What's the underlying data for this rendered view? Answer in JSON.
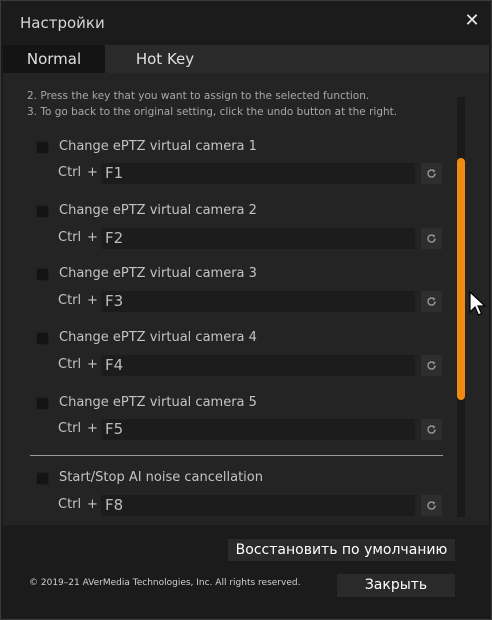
{
  "window": {
    "title": "Настройки",
    "close_glyph": "✕"
  },
  "tabs": [
    {
      "label": "Normal",
      "active": true
    },
    {
      "label": "Hot Key",
      "active": false
    }
  ],
  "instructions": [
    "2. Press the key that you want to assign to the selected function.",
    "3. To go back to the original setting, click the undo button at the right."
  ],
  "hotkeys": [
    {
      "label": "Change ePTZ virtual camera 1",
      "modifier": "Ctrl",
      "plus": "+",
      "key": "F1",
      "checked": false
    },
    {
      "label": "Change ePTZ virtual camera 2",
      "modifier": "Ctrl",
      "plus": "+",
      "key": "F2",
      "checked": false
    },
    {
      "label": "Change ePTZ virtual camera 3",
      "modifier": "Ctrl",
      "plus": "+",
      "key": "F3",
      "checked": false
    },
    {
      "label": "Change ePTZ virtual camera 4",
      "modifier": "Ctrl",
      "plus": "+",
      "key": "F4",
      "checked": false
    },
    {
      "label": "Change ePTZ virtual camera 5",
      "modifier": "Ctrl",
      "plus": "+",
      "key": "F5",
      "checked": false
    },
    {
      "label": "Start/Stop AI noise cancellation",
      "modifier": "Ctrl",
      "plus": "+",
      "key": "F8",
      "checked": false
    }
  ],
  "footer": {
    "restore_label": "Восстановить по умолчанию",
    "close_label": "Закрыть",
    "copyright": "© 2019–21 AVerMedia Technologies, Inc. All rights reserved."
  },
  "colors": {
    "accent": "#f08a12",
    "background": "#1b1b1b",
    "panel": "#242424"
  },
  "icons": {
    "undo": "undo-icon",
    "close": "close-icon",
    "cursor": "mouse-cursor-icon"
  }
}
